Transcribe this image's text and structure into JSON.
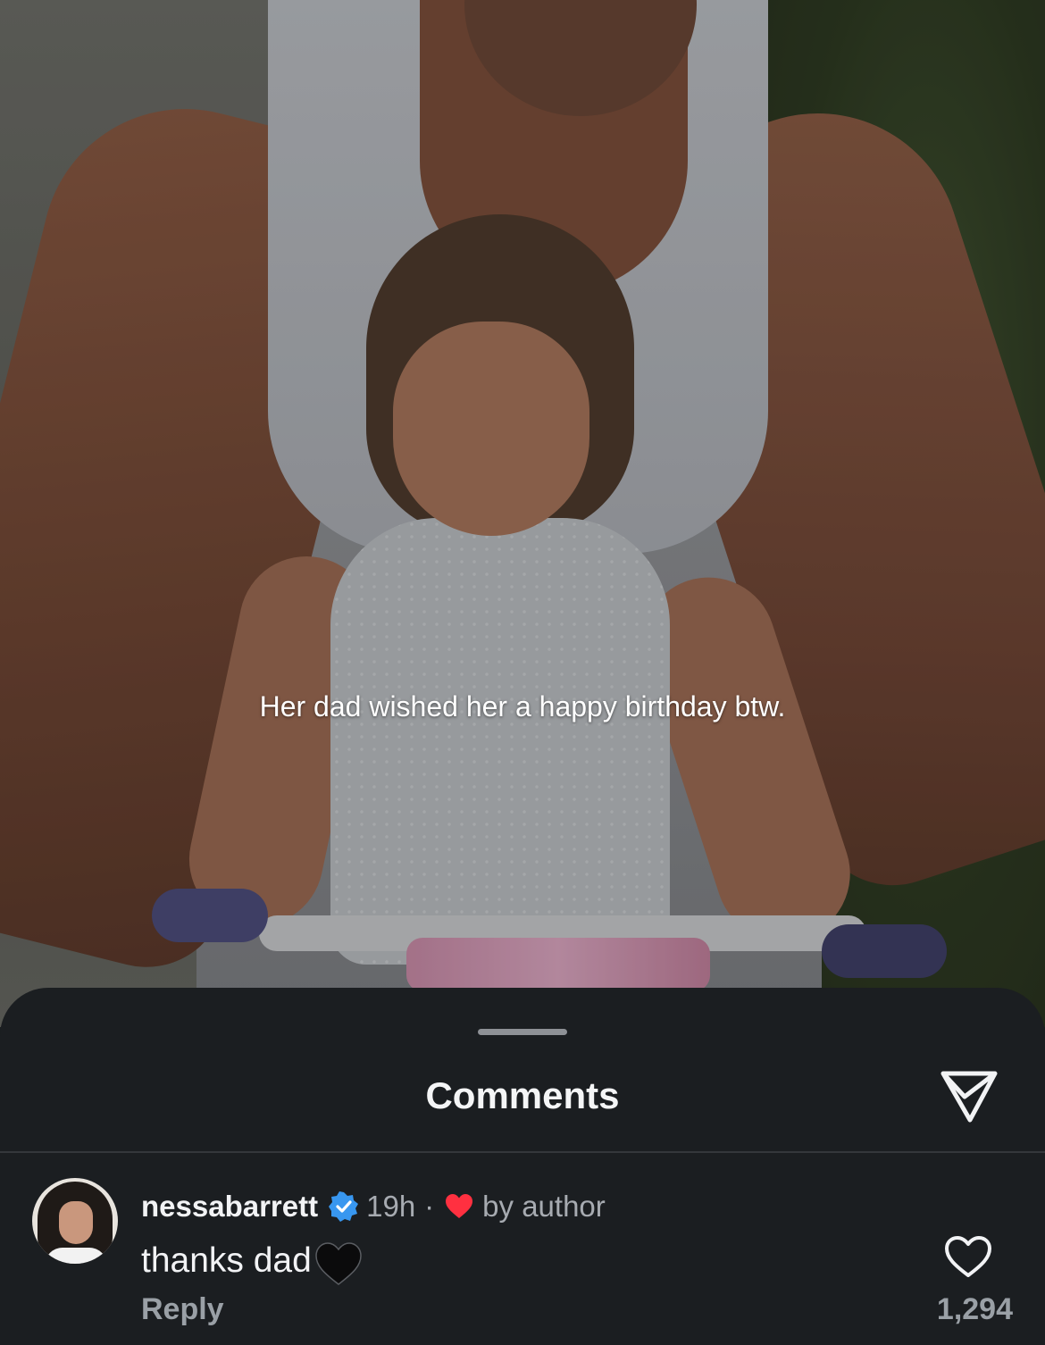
{
  "post": {
    "caption": "Her dad wished her a happy birthday btw."
  },
  "sheet": {
    "title": "Comments",
    "share_icon": "paper-plane-icon"
  },
  "comment": {
    "username": "nessabarrett",
    "verified_icon": "verified-badge-icon",
    "time": "19h",
    "separator": "·",
    "liked_by_author_icon": "red-heart-icon",
    "liked_by_author_label": "by author",
    "text": "thanks dad",
    "emoji_icon": "black-heart-icon",
    "reply_label": "Reply",
    "like_icon": "heart-outline-icon",
    "like_count": "1,294"
  },
  "colors": {
    "sheet_background": "#1b1e21",
    "verified_blue": "#3897f0",
    "author_heart_red": "#ff3040"
  }
}
